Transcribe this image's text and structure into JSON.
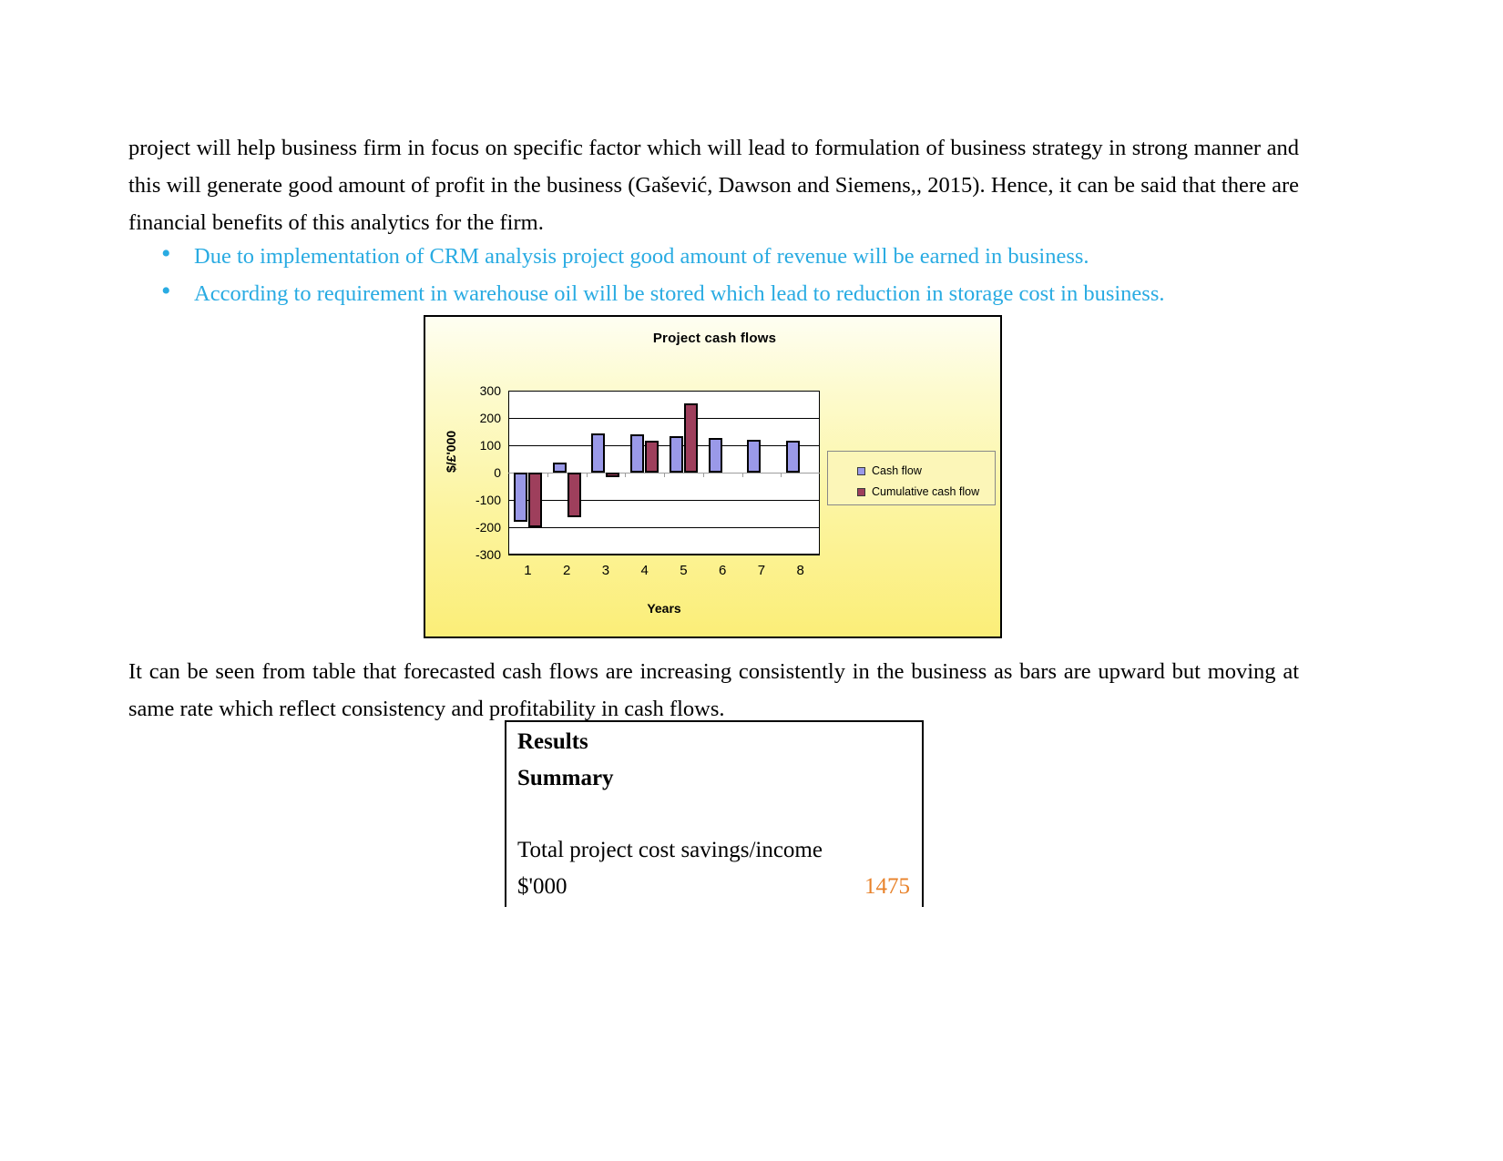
{
  "document": {
    "paragraph_top": "project will help business firm in focus on specific factor which will lead to formulation of business strategy in strong manner and this will generate good amount of profit in the business (Gašević,  Dawson and Siemens,, 2015). Hence, it can be said that there are financial benefits of this analytics for the firm.",
    "paragraph_bottom": "It can be seen from table that forecasted cash flows are increasing consistently in the business as bars are upward but moving at same rate which reflect consistency and profitability in cash flows.",
    "bullets": [
      "Due to implementation of CRM analysis project good amount of revenue will be earned in business.",
      "According to requirement in warehouse oil will be stored which lead to reduction in storage cost in business."
    ],
    "bullet_marker": "•",
    "bullet_color": "#29abe2"
  },
  "chart_data": {
    "type": "bar",
    "title": "Project cash flows",
    "xlabel": "Years",
    "ylabel": "$/£'000",
    "categories": [
      "1",
      "2",
      "3",
      "4",
      "5",
      "6",
      "7",
      "8"
    ],
    "yticks": [
      "300",
      "200",
      "100",
      "0",
      "-100",
      "-200",
      "-300"
    ],
    "ylim": [
      -300,
      300
    ],
    "grid": true,
    "legend_position": "right",
    "series": [
      {
        "name": "Cash flow",
        "color": "#9a99e8",
        "values": [
          -180,
          38,
          143,
          140,
          133,
          127,
          121,
          116
        ]
      },
      {
        "name": "Cumulative cash flow",
        "color": "#9e3f5c",
        "values": [
          -200,
          -162,
          -18,
          118,
          255,
          null,
          null,
          null
        ]
      }
    ],
    "plot_background": "#ffffff",
    "chart_background_top": "#fefef2",
    "chart_background_bottom": "#fbee78"
  },
  "results_table": {
    "heading_line1": "Results",
    "heading_line2": "Summary",
    "row_label": "Total project cost savings/income",
    "unit_label": "$'000",
    "value": "1475",
    "value_color": "#e8822a"
  }
}
